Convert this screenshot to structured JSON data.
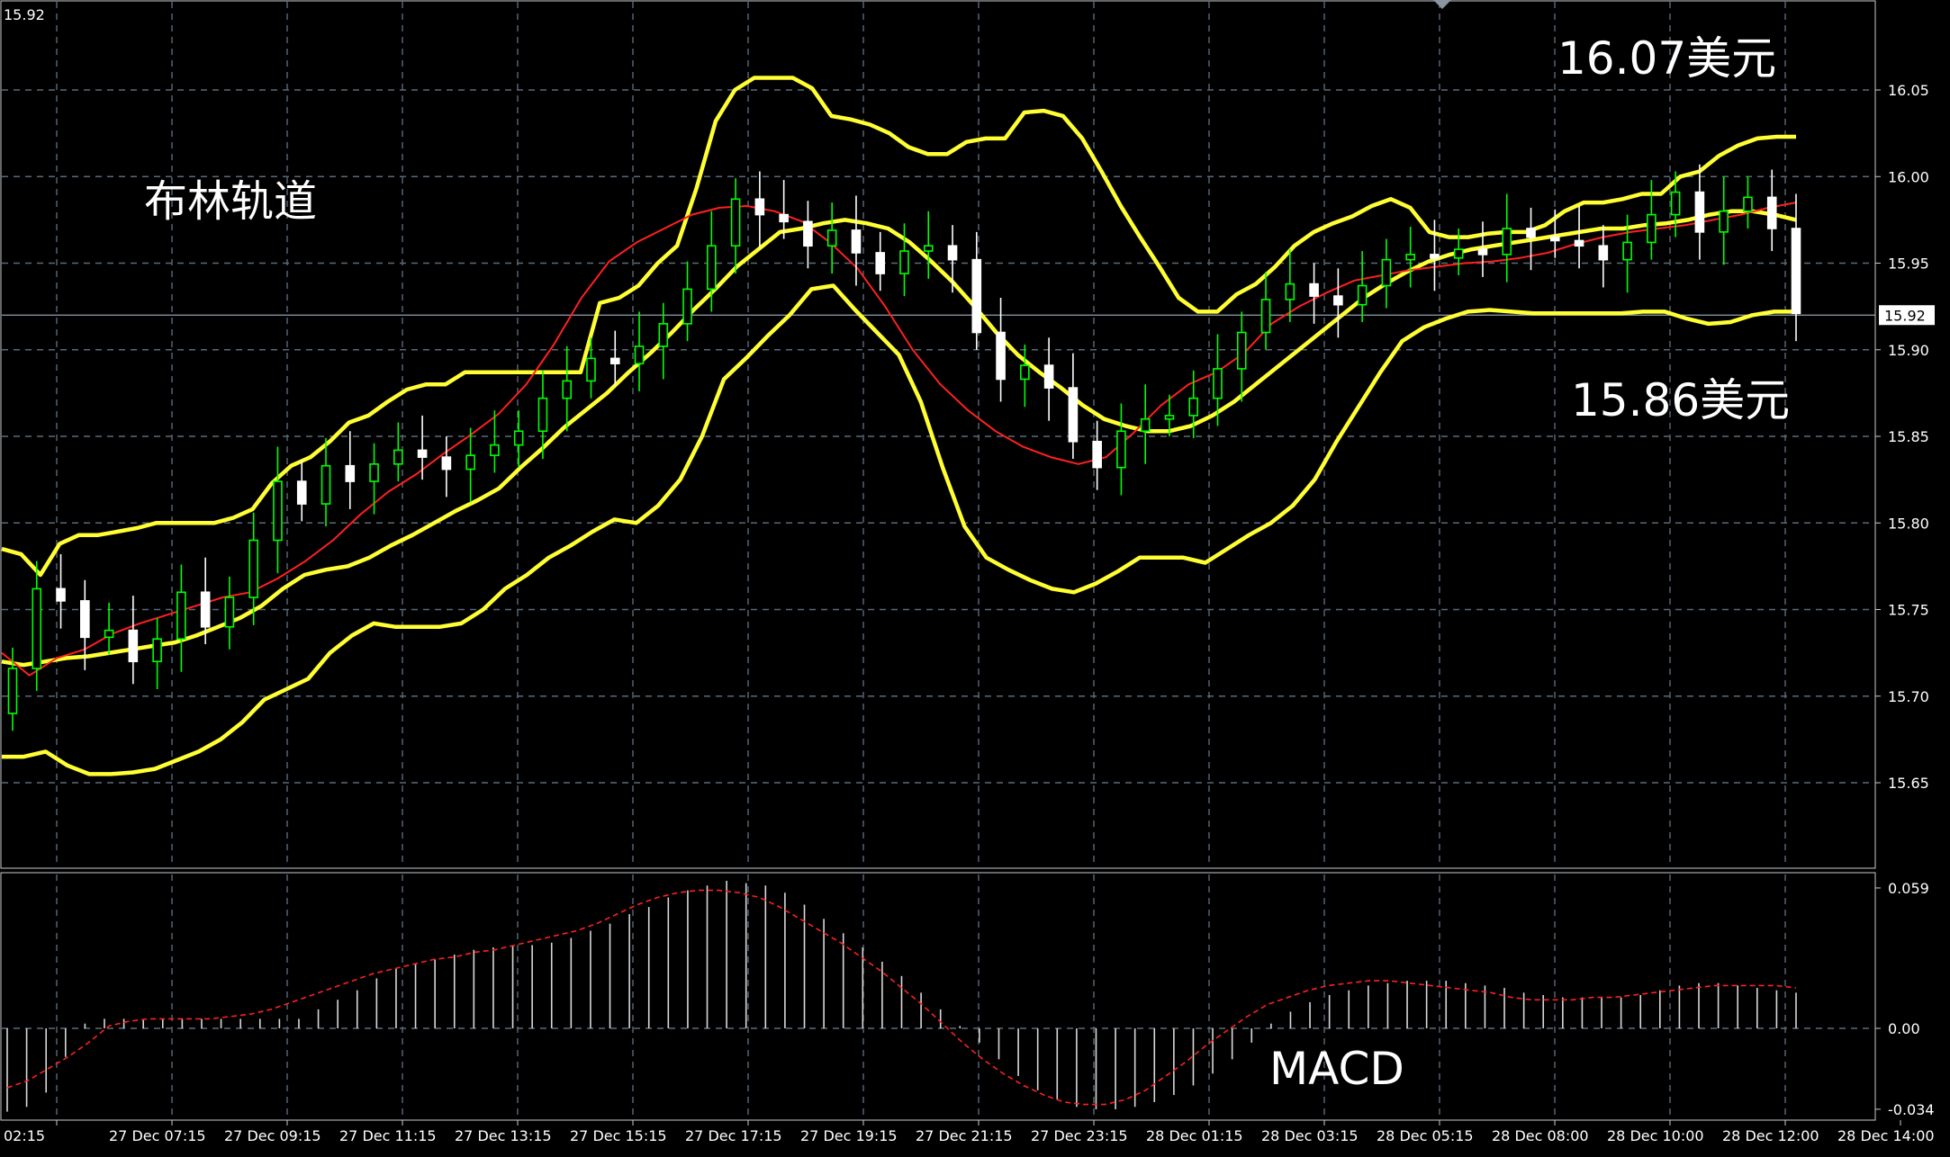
{
  "window": {
    "corner_price": "15.92"
  },
  "chart_data": [
    {
      "type": "candlestick",
      "title": "",
      "ylim": [
        15.605,
        16.1
      ],
      "y_ticks": [
        "16.05",
        "16.00",
        "15.95",
        "15.90",
        "15.85",
        "15.80",
        "15.75",
        "15.70",
        "15.65"
      ],
      "x_ticks": [
        "02:15",
        "27 Dec 07:15",
        "27 Dec 09:15",
        "27 Dec 11:15",
        "27 Dec 13:15",
        "27 Dec 15:15",
        "27 Dec 17:15",
        "27 Dec 19:15",
        "27 Dec 21:15",
        "27 Dec 23:15",
        "28 Dec 01:15",
        "28 Dec 03:15",
        "28 Dec 05:15",
        "28 Dec 08:00",
        "28 Dec 10:00",
        "28 Dec 12:00",
        "28 Dec 14:00"
      ],
      "current_price": "15.92",
      "grid": true,
      "colors": {
        "bull": "#00ff00",
        "bear": "#ffffff",
        "band": "#ffff33",
        "middle": "#ff2020",
        "grid": "#5a6a7a"
      },
      "annotations": {
        "indicator_name": "布林轨道",
        "high_label": "16.07美元",
        "low_label": "15.86美元"
      },
      "series": [
        {
          "name": "upper-band",
          "values": [
            15.785,
            15.782,
            15.77,
            15.788,
            15.793,
            15.793,
            15.795,
            15.797,
            15.8,
            15.8,
            15.8,
            15.8,
            15.803,
            15.808,
            15.823,
            15.833,
            15.838,
            15.847,
            15.858,
            15.862,
            15.87,
            15.877,
            15.88,
            15.88,
            15.887,
            15.887,
            15.887,
            15.887,
            15.887,
            15.887,
            15.887,
            15.927,
            15.93,
            15.937,
            15.95,
            15.96,
            15.993,
            16.032,
            16.05,
            16.057,
            16.057,
            16.057,
            16.051,
            16.035,
            16.033,
            16.03,
            16.025,
            16.017,
            16.013,
            16.013,
            16.02,
            16.022,
            16.022,
            16.037,
            16.038,
            16.035,
            16.022,
            16.003,
            15.983,
            15.965,
            15.948,
            15.93,
            15.922,
            15.922,
            15.932,
            15.938,
            15.948,
            15.96,
            15.968,
            15.973,
            15.977,
            15.983,
            15.987,
            15.982,
            15.968,
            15.965,
            15.965,
            15.967,
            15.968,
            15.968,
            15.972,
            15.98,
            15.985,
            15.985,
            15.987,
            15.99,
            15.99,
            16.0,
            16.003,
            16.012,
            16.018,
            16.022,
            16.023,
            16.023
          ]
        },
        {
          "name": "middle-band",
          "values": [
            15.72,
            15.718,
            15.72,
            15.722,
            15.723,
            15.725,
            15.727,
            15.729,
            15.731,
            15.735,
            15.74,
            15.745,
            15.752,
            15.762,
            15.77,
            15.773,
            15.775,
            15.78,
            15.787,
            15.793,
            15.8,
            15.807,
            15.813,
            15.82,
            15.832,
            15.843,
            15.855,
            15.865,
            15.875,
            15.887,
            15.898,
            15.91,
            15.923,
            15.935,
            15.948,
            15.958,
            15.968,
            15.97,
            15.973,
            15.975,
            15.973,
            15.97,
            15.962,
            15.951,
            15.939,
            15.925,
            15.91,
            15.897,
            15.887,
            15.878,
            15.868,
            15.86,
            15.856,
            15.853,
            15.853,
            15.856,
            15.862,
            15.87,
            15.88,
            15.89,
            15.9,
            15.91,
            15.92,
            15.93,
            15.938,
            15.945,
            15.951,
            15.955,
            15.958,
            15.96,
            15.962,
            15.964,
            15.966,
            15.968,
            15.97,
            15.97,
            15.972,
            15.973,
            15.975,
            15.978,
            15.98,
            15.98,
            15.978,
            15.975
          ]
        },
        {
          "name": "lower-band",
          "values": [
            15.665,
            15.665,
            15.668,
            15.66,
            15.655,
            15.655,
            15.656,
            15.658,
            15.663,
            15.668,
            15.675,
            15.685,
            15.698,
            15.704,
            15.71,
            15.725,
            15.735,
            15.742,
            15.74,
            15.74,
            15.74,
            15.742,
            15.75,
            15.762,
            15.77,
            15.78,
            15.787,
            15.795,
            15.802,
            15.8,
            15.81,
            15.825,
            15.85,
            15.883,
            15.895,
            15.908,
            15.92,
            15.935,
            15.937,
            15.923,
            15.91,
            15.897,
            15.87,
            15.832,
            15.798,
            15.78,
            15.773,
            15.767,
            15.762,
            15.76,
            15.765,
            15.772,
            15.78,
            15.78,
            15.78,
            15.777,
            15.785,
            15.793,
            15.8,
            15.81,
            15.825,
            15.847,
            15.867,
            15.887,
            15.905,
            15.913,
            15.918,
            15.922,
            15.923,
            15.922,
            15.921,
            15.921,
            15.921,
            15.921,
            15.921,
            15.922,
            15.922,
            15.918,
            15.915,
            15.916,
            15.92,
            15.922,
            15.922
          ]
        },
        {
          "name": "red-ma",
          "values": [
            15.725,
            15.712,
            15.722,
            15.727,
            15.736,
            15.742,
            15.747,
            15.752,
            15.757,
            15.76,
            15.768,
            15.778,
            15.79,
            15.805,
            15.818,
            15.828,
            15.84,
            15.851,
            15.863,
            15.88,
            15.903,
            15.93,
            15.951,
            15.962,
            15.97,
            15.978,
            15.982,
            15.983,
            15.98,
            15.974,
            15.962,
            15.947,
            15.925,
            15.9,
            15.88,
            15.865,
            15.853,
            15.844,
            15.838,
            15.834,
            15.838,
            15.852,
            15.868,
            15.88,
            15.887,
            15.898,
            15.915,
            15.925,
            15.933,
            15.94,
            15.943,
            15.946,
            15.948,
            15.95,
            15.951,
            15.953,
            15.956,
            15.961,
            15.965,
            15.968,
            15.97,
            15.972,
            15.975,
            15.978,
            15.982,
            15.985
          ]
        }
      ],
      "candles": {
        "open": [
          15.69,
          15.716,
          15.762,
          15.755,
          15.734,
          15.738,
          15.72,
          15.733,
          15.76,
          15.74,
          15.757,
          15.79,
          15.824,
          15.811,
          15.833,
          15.824,
          15.834,
          15.842,
          15.838,
          15.831,
          15.839,
          15.845,
          15.853,
          15.872,
          15.882,
          15.895,
          15.892,
          15.902,
          15.915,
          15.935,
          15.96,
          15.987,
          15.978,
          15.974,
          15.96,
          15.969,
          15.956,
          15.944,
          15.957,
          15.96,
          15.952,
          15.91,
          15.883,
          15.891,
          15.878,
          15.847,
          15.832,
          15.853,
          15.86,
          15.862,
          15.872,
          15.889,
          15.91,
          15.929,
          15.938,
          15.931,
          15.926,
          15.937,
          15.952,
          15.955,
          15.953,
          15.958,
          15.955,
          15.97,
          15.965,
          15.963,
          15.96,
          15.952,
          15.962,
          15.978,
          15.991,
          15.968,
          15.98,
          15.988,
          15.97
        ],
        "close": [
          15.716,
          15.762,
          15.755,
          15.734,
          15.738,
          15.72,
          15.733,
          15.76,
          15.74,
          15.757,
          15.79,
          15.824,
          15.811,
          15.833,
          15.824,
          15.834,
          15.842,
          15.838,
          15.831,
          15.839,
          15.845,
          15.853,
          15.872,
          15.882,
          15.895,
          15.892,
          15.902,
          15.915,
          15.935,
          15.96,
          15.987,
          15.978,
          15.974,
          15.96,
          15.969,
          15.956,
          15.944,
          15.957,
          15.96,
          15.952,
          15.91,
          15.883,
          15.891,
          15.878,
          15.847,
          15.832,
          15.853,
          15.86,
          15.862,
          15.872,
          15.889,
          15.91,
          15.929,
          15.938,
          15.931,
          15.926,
          15.937,
          15.952,
          15.955,
          15.953,
          15.958,
          15.955,
          15.97,
          15.965,
          15.963,
          15.96,
          15.952,
          15.962,
          15.978,
          15.991,
          15.968,
          15.98,
          15.988,
          15.97,
          15.921
        ]
      },
      "current_label": "15.92"
    },
    {
      "type": "macd",
      "ylim": [
        -0.04,
        0.065
      ],
      "y_ticks": [
        "0.059",
        "0.00",
        "-0.034"
      ],
      "annotations": {
        "indicator_name": "MACD"
      },
      "histogram": [
        -0.035,
        -0.033,
        -0.027,
        -0.012,
        0.002,
        0.004,
        0.004,
        0.004,
        0.004,
        0.004,
        0.004,
        0.004,
        0.004,
        0.004,
        0.004,
        0.004,
        0.008,
        0.012,
        0.016,
        0.021,
        0.025,
        0.027,
        0.029,
        0.031,
        0.033,
        0.034,
        0.035,
        0.035,
        0.036,
        0.038,
        0.041,
        0.044,
        0.048,
        0.051,
        0.055,
        0.058,
        0.06,
        0.062,
        0.061,
        0.06,
        0.057,
        0.052,
        0.046,
        0.04,
        0.034,
        0.028,
        0.022,
        0.015,
        0.008,
        0.001,
        -0.006,
        -0.013,
        -0.02,
        -0.026,
        -0.03,
        -0.033,
        -0.034,
        -0.034,
        -0.033,
        -0.031,
        -0.028,
        -0.024,
        -0.019,
        -0.013,
        -0.006,
        0.002,
        0.007,
        0.011,
        0.014,
        0.016,
        0.018,
        0.019,
        0.02,
        0.02,
        0.02,
        0.019,
        0.018,
        0.017,
        0.015,
        0.014,
        0.013,
        0.013,
        0.013,
        0.013,
        0.014,
        0.016,
        0.018,
        0.019,
        0.019,
        0.018,
        0.017,
        0.016,
        0.015
      ],
      "signal_line": [
        -0.025,
        -0.022,
        -0.017,
        -0.012,
        -0.006,
        0.001,
        0.003,
        0.004,
        0.004,
        0.004,
        0.004,
        0.005,
        0.006,
        0.008,
        0.011,
        0.014,
        0.017,
        0.02,
        0.023,
        0.025,
        0.027,
        0.029,
        0.03,
        0.032,
        0.033,
        0.035,
        0.037,
        0.039,
        0.041,
        0.044,
        0.048,
        0.052,
        0.055,
        0.057,
        0.058,
        0.058,
        0.057,
        0.055,
        0.051,
        0.046,
        0.041,
        0.036,
        0.03,
        0.024,
        0.017,
        0.01,
        0.002,
        -0.006,
        -0.013,
        -0.019,
        -0.024,
        -0.028,
        -0.031,
        -0.032,
        -0.032,
        -0.03,
        -0.026,
        -0.02,
        -0.014,
        -0.007,
        -0.001,
        0.005,
        0.01,
        0.013,
        0.016,
        0.018,
        0.019,
        0.02,
        0.02,
        0.019,
        0.018,
        0.017,
        0.016,
        0.015,
        0.013,
        0.012,
        0.012,
        0.012,
        0.013,
        0.013,
        0.014,
        0.015,
        0.016,
        0.017,
        0.018,
        0.018,
        0.018,
        0.018,
        0.017
      ]
    }
  ]
}
